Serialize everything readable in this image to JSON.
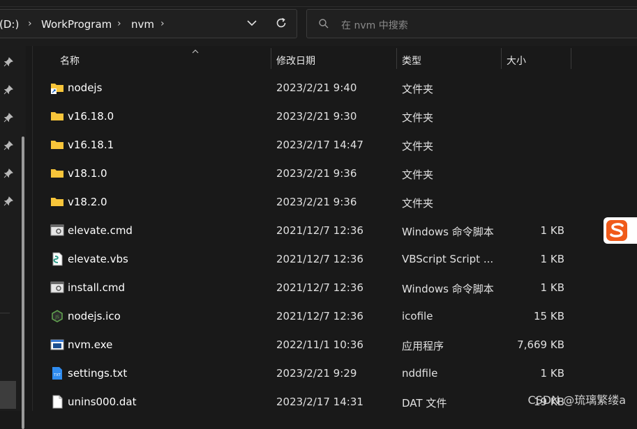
{
  "address_bar": {
    "drive": "(D:)",
    "segments": [
      "WorkProgram",
      "nvm"
    ]
  },
  "search": {
    "placeholder": "在 nvm 中搜索"
  },
  "columns": {
    "name": "名称",
    "date": "修改日期",
    "type": "类型",
    "size": "大小"
  },
  "files": [
    {
      "name": "nodejs",
      "date": "2023/2/21 9:40",
      "type": "文件夹",
      "size": "",
      "icon": "folder-shortcut-icon"
    },
    {
      "name": "v16.18.0",
      "date": "2023/2/21 9:30",
      "type": "文件夹",
      "size": "",
      "icon": "folder-icon"
    },
    {
      "name": "v16.18.1",
      "date": "2023/2/17 14:47",
      "type": "文件夹",
      "size": "",
      "icon": "folder-icon"
    },
    {
      "name": "v18.1.0",
      "date": "2023/2/21 9:36",
      "type": "文件夹",
      "size": "",
      "icon": "folder-icon"
    },
    {
      "name": "v18.2.0",
      "date": "2023/2/21 9:36",
      "type": "文件夹",
      "size": "",
      "icon": "folder-icon"
    },
    {
      "name": "elevate.cmd",
      "date": "2021/12/7 12:36",
      "type": "Windows 命令脚本",
      "size": "1 KB",
      "icon": "cmd-script-icon"
    },
    {
      "name": "elevate.vbs",
      "date": "2021/12/7 12:36",
      "type": "VBScript Script ...",
      "size": "1 KB",
      "icon": "vbs-script-icon"
    },
    {
      "name": "install.cmd",
      "date": "2021/12/7 12:36",
      "type": "Windows 命令脚本",
      "size": "1 KB",
      "icon": "cmd-script-icon"
    },
    {
      "name": "nodejs.ico",
      "date": "2021/12/7 12:36",
      "type": "icofile",
      "size": "15 KB",
      "icon": "nodejs-icon"
    },
    {
      "name": "nvm.exe",
      "date": "2022/11/1 10:36",
      "type": "应用程序",
      "size": "7,669 KB",
      "icon": "exe-icon"
    },
    {
      "name": "settings.txt",
      "date": "2023/2/21 9:29",
      "type": "nddfile",
      "size": "1 KB",
      "icon": "txt-icon"
    },
    {
      "name": "unins000.dat",
      "date": "2023/2/17 14:31",
      "type": "DAT 文件",
      "size": "19 KB",
      "icon": "dat-file-icon"
    }
  ],
  "watermark": "CSDN @琉璃繁缕a",
  "colors": {
    "background": "#191919",
    "folder": "#f8c53a",
    "ime_accent": "#f05a1a"
  }
}
